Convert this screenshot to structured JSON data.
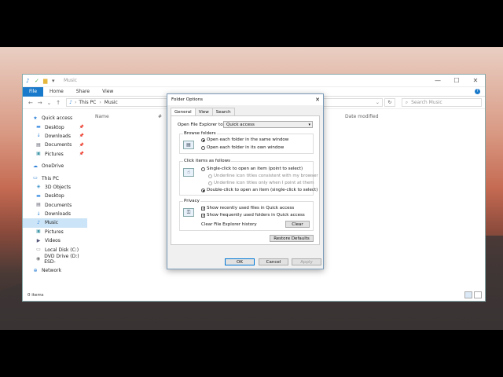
{
  "explorer": {
    "title": "Music",
    "ribbon_tabs": [
      "File",
      "Home",
      "Share",
      "View"
    ],
    "address": {
      "segments": [
        "This PC",
        "Music"
      ]
    },
    "search_placeholder": "Search Music",
    "columns": {
      "name": "Name",
      "hash": "#",
      "date": "Date modified"
    },
    "status": "0 items",
    "sidebar": [
      {
        "label": "Quick access",
        "icon": "star-icon",
        "kind": "root"
      },
      {
        "label": "Desktop",
        "icon": "folder-icon",
        "kind": "child",
        "pinned": true
      },
      {
        "label": "Downloads",
        "icon": "download-icon",
        "kind": "child",
        "pinned": true
      },
      {
        "label": "Documents",
        "icon": "document-icon",
        "kind": "child",
        "pinned": true
      },
      {
        "label": "Pictures",
        "icon": "picture-icon",
        "kind": "child",
        "pinned": true
      },
      {
        "label": "OneDrive",
        "icon": "cloud-icon",
        "kind": "root"
      },
      {
        "label": "This PC",
        "icon": "pc-icon",
        "kind": "root"
      },
      {
        "label": "3D Objects",
        "icon": "cube-icon",
        "kind": "child"
      },
      {
        "label": "Desktop",
        "icon": "folder-icon",
        "kind": "child"
      },
      {
        "label": "Documents",
        "icon": "document-icon",
        "kind": "child"
      },
      {
        "label": "Downloads",
        "icon": "download-icon",
        "kind": "child"
      },
      {
        "label": "Music",
        "icon": "music-icon",
        "kind": "child",
        "selected": true
      },
      {
        "label": "Pictures",
        "icon": "picture-icon",
        "kind": "child"
      },
      {
        "label": "Videos",
        "icon": "video-icon",
        "kind": "child"
      },
      {
        "label": "Local Disk (C:)",
        "icon": "disk-icon",
        "kind": "child"
      },
      {
        "label": "DVD Drive (D:) ESD-",
        "icon": "dvd-icon",
        "kind": "child"
      },
      {
        "label": "Network",
        "icon": "network-icon",
        "kind": "root"
      }
    ]
  },
  "dialog": {
    "title": "Folder Options",
    "tabs": [
      "General",
      "View",
      "Search"
    ],
    "open_label": "Open File Explorer to:",
    "open_value": "Quick access",
    "browse": {
      "title": "Browse folders",
      "options": [
        "Open each folder in the same window",
        "Open each folder in its own window"
      ]
    },
    "click": {
      "title": "Click items as follows",
      "single": "Single-click to open an item (point to select)",
      "underline_browser": "Underline icon titles consistent with my browser",
      "underline_point": "Underline icon titles only when I point at them",
      "double": "Double-click to open an item (single-click to select)"
    },
    "privacy": {
      "title": "Privacy",
      "recent_files": "Show recently used files in Quick access",
      "frequent_folders": "Show frequently used folders in Quick access",
      "clear_label": "Clear File Explorer history",
      "clear_button": "Clear"
    },
    "restore_button": "Restore Defaults",
    "ok": "OK",
    "cancel": "Cancel",
    "apply": "Apply"
  }
}
